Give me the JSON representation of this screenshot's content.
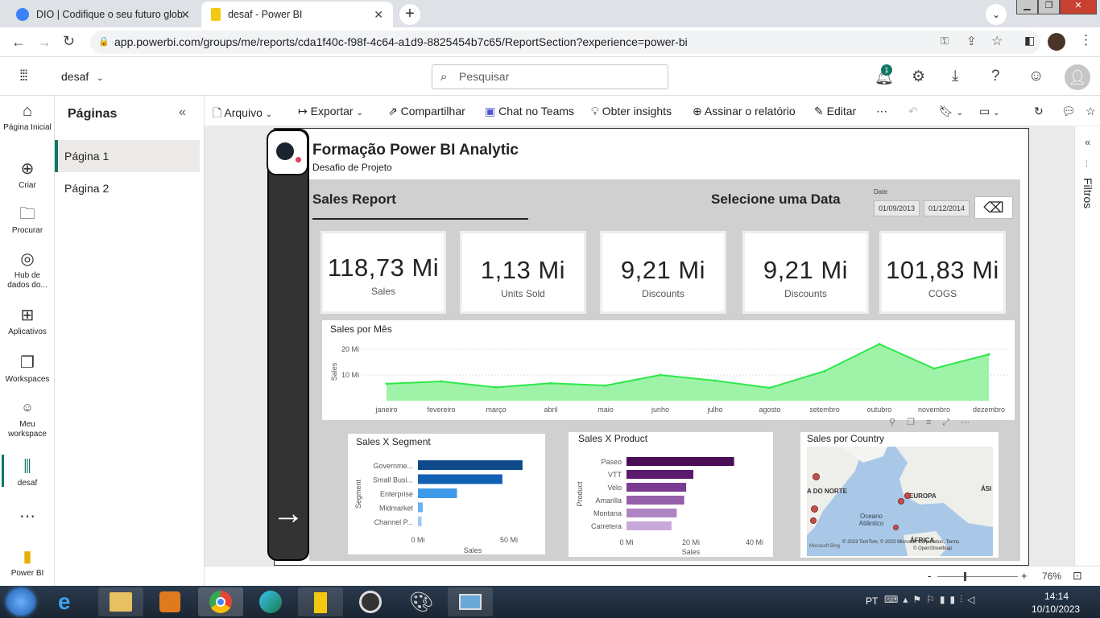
{
  "browser": {
    "tabs": [
      {
        "title": "DIO | Codifique o seu futuro glob",
        "active": false
      },
      {
        "title": "desaf - Power BI",
        "active": true
      }
    ],
    "url": "app.powerbi.com/groups/me/reports/cda1f40c-f98f-4c64-a1d9-8825454b7c65/ReportSection?experience=power-bi"
  },
  "header": {
    "workspace": "desaf",
    "search_placeholder": "Pesquisar",
    "notification_count": "1"
  },
  "rail": [
    {
      "label": "Página Inicial",
      "icon": "home-icon"
    },
    {
      "label": "Criar",
      "icon": "create-icon"
    },
    {
      "label": "Procurar",
      "icon": "browse-icon"
    },
    {
      "label": "Hub de dados do...",
      "icon": "data-hub-icon"
    },
    {
      "label": "Aplicativos",
      "icon": "apps-icon"
    },
    {
      "label": "Workspaces",
      "icon": "workspaces-icon"
    },
    {
      "label": "Meu workspace",
      "icon": "my-workspace-icon"
    },
    {
      "label": "desaf",
      "icon": "report-icon"
    },
    {
      "label": "Power BI",
      "icon": "powerbi-icon"
    }
  ],
  "pages": {
    "title": "Páginas",
    "items": [
      "Página 1",
      "Página 2"
    ],
    "active": "Página 1"
  },
  "toolbar": {
    "arquivo": "Arquivo",
    "exportar": "Exportar",
    "compartilhar": "Compartilhar",
    "chat": "Chat no Teams",
    "insights": "Obter insights",
    "assinar": "Assinar o relatório",
    "editar": "Editar"
  },
  "report": {
    "title": "Formação Power BI Analytic",
    "subtitle": "Desafio de Projeto",
    "section_title": "Sales Report",
    "date_prompt": "Selecione uma Data",
    "date_label": "Date",
    "date_start": "01/09/2013",
    "date_end": "01/12/2014",
    "cards": [
      {
        "value": "118,73 Mi",
        "label": "Sales"
      },
      {
        "value": "1,13 Mi",
        "label": "Units Sold"
      },
      {
        "value": "9,21 Mi",
        "label": "Discounts"
      },
      {
        "value": "9,21 Mi",
        "label": "Discounts"
      },
      {
        "value": "101,83 Mi",
        "label": "COGS"
      }
    ]
  },
  "chart_data": [
    {
      "type": "area",
      "title": "Sales por Mês",
      "xlabel": "",
      "ylabel": "Sales",
      "categories": [
        "janeiro",
        "fevereiro",
        "março",
        "abril",
        "maio",
        "junho",
        "julho",
        "agosto",
        "setembro",
        "outubro",
        "novembro",
        "dezembro"
      ],
      "values": [
        6.6,
        7.5,
        5.2,
        6.8,
        5.9,
        10.0,
        7.8,
        5.0,
        11.5,
        22.0,
        12.5,
        18.0
      ],
      "ytick_labels": [
        "10 Mi",
        "20 Mi"
      ],
      "ylim": [
        0,
        25
      ],
      "color": "#2ee84a"
    },
    {
      "type": "bar",
      "title": "Sales X Segment",
      "xlabel": "Sales",
      "ylabel": "Segment",
      "categories": [
        "Governme...",
        "Small Busi...",
        "Enterprise",
        "Midmarket",
        "Channel P..."
      ],
      "values": [
        52.5,
        42.4,
        19.6,
        2.4,
        1.8
      ],
      "colors": [
        "#0e4a8a",
        "#1260b4",
        "#3d9ae8",
        "#64b2f4",
        "#9ccaf8"
      ],
      "xtick_labels": [
        "0 Mi",
        "50 Mi"
      ],
      "xlim": [
        0,
        57
      ]
    },
    {
      "type": "bar",
      "title": "Sales X Product",
      "xlabel": "Sales",
      "ylabel": "Product",
      "categories": [
        "Paseo",
        "VTT",
        "Velo",
        "Amarilla",
        "Montana",
        "Carretera"
      ],
      "values": [
        33.0,
        20.5,
        18.3,
        17.7,
        15.4,
        13.8
      ],
      "colors": [
        "#4a0e57",
        "#5c1a6e",
        "#7a3b92",
        "#9560aa",
        "#ae84c2",
        "#c9a9d9"
      ],
      "xtick_labels": [
        "0 Mi",
        "20 Mi",
        "40 Mi"
      ],
      "xlim": [
        0,
        40
      ]
    }
  ],
  "map": {
    "title": "Sales por Country",
    "labels": [
      "A DO NORTE",
      "EUROPA",
      "ÁSI",
      "Oceano Atlântico",
      "ÁFRICA"
    ],
    "attribution": "© 2023 TomTom, © 2023 Microsoft Corporation, Terms",
    "osm": "© OpenStreetMap",
    "brand": "Microsoft Bing"
  },
  "filters_label": "Filtros",
  "zoom": "76%",
  "taskbar": {
    "lang": "PT",
    "time": "14:14",
    "date": "10/10/2023"
  }
}
